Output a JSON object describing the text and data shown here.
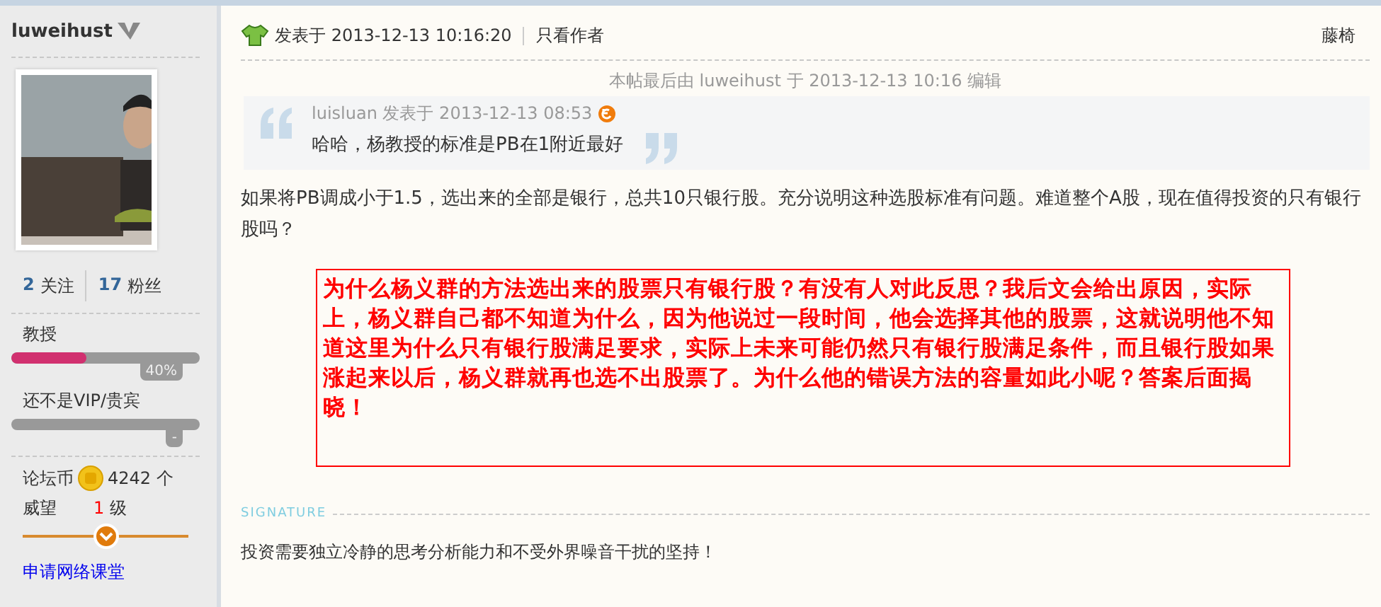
{
  "sidebar": {
    "username": "luweihust",
    "stats": [
      {
        "count": "2",
        "label": "关注"
      },
      {
        "count": "17",
        "label": "粉丝"
      }
    ],
    "meters": [
      {
        "title": "教授",
        "level": 0.4,
        "reading": "40%"
      },
      {
        "title": "还不是VIP/贵宾",
        "reading": "-"
      }
    ],
    "coins": {
      "label": "论坛币",
      "value": "4242",
      "unit": "个"
    },
    "prestige": {
      "label": "威望",
      "value": "1",
      "unit": "级",
      "level": 0.5
    },
    "link": "申请网络课堂"
  },
  "post": {
    "posted": "发表于 2013-12-13 10:16:20",
    "only_author": "只看作者",
    "floor": "藤椅",
    "edit_note": "本帖最后由 luweihust 于 2013-12-13 10:16 编辑",
    "quote": {
      "byline": "luisluan 发表于 2013-12-13 08:53",
      "text": "哈哈，杨教授的标准是PB在1附近最好"
    },
    "body": "如果将PB调成小于1.5，选出来的全部是银行，总共10只银行股。充分说明这种选股标准有问题。难道整个A股，现在值得投资的只有银行股吗？",
    "highlight": "为什么杨义群的方法选出来的股票只有银行股？有没有人对此反思？我后文会给出原因，实际上，杨义群自己都不知道为什么，因为他说过一段时间，他会选择其他的股票，这就说明他不知道这里为什么只有银行股满足要求，实际上未来可能仍然只有银行股满足条件，而且银行股如果涨起来以后，杨义群就再也选不出股票了。为什么他的错误方法的容量如此小呢？答案后面揭晓！",
    "signature_label": "SIGNATURE",
    "signature": "投资需要独立冷静的思考分析能力和不受外界噪音干扰的坚持！"
  }
}
